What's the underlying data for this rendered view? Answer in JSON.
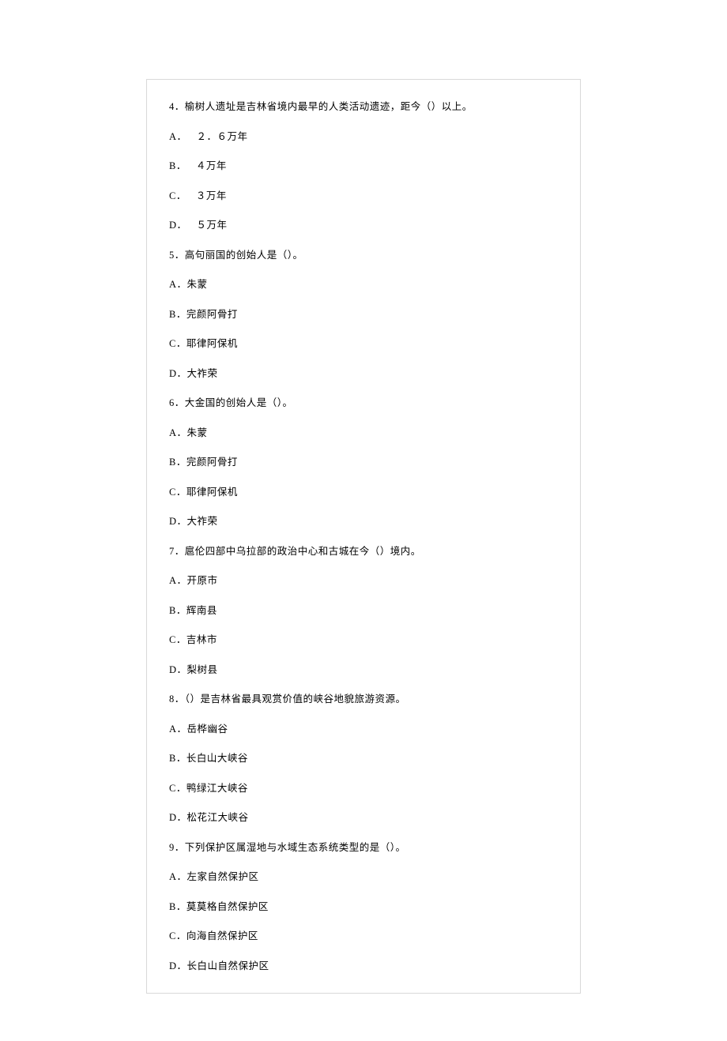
{
  "questions": [
    {
      "num": "4．",
      "stem": "榆树人遗址是吉林省境内最早的人类活动遗迹，距今（）以上。",
      "options": [
        {
          "letter": "A．",
          "text": "２．６万年",
          "wide": true
        },
        {
          "letter": "B．",
          "text": "４万年",
          "wide": true
        },
        {
          "letter": "C．",
          "text": "３万年",
          "wide": true
        },
        {
          "letter": "D．",
          "text": "５万年",
          "wide": true
        }
      ]
    },
    {
      "num": "5．",
      "stem": "高句丽国的创始人是（）。",
      "options": [
        {
          "letter": "A．",
          "text": "朱蒙"
        },
        {
          "letter": "B．",
          "text": "完颜阿骨打"
        },
        {
          "letter": "C．",
          "text": "耶律阿保机"
        },
        {
          "letter": "D．",
          "text": "大祚荣"
        }
      ]
    },
    {
      "num": "6．",
      "stem": "大金国的创始人是（）。",
      "options": [
        {
          "letter": "A．",
          "text": "朱蒙"
        },
        {
          "letter": "B．",
          "text": "完颜阿骨打"
        },
        {
          "letter": "C．",
          "text": "耶律阿保机"
        },
        {
          "letter": "D．",
          "text": "大祚荣"
        }
      ]
    },
    {
      "num": "7．",
      "stem": "扈伦四部中乌拉部的政治中心和古城在今（）境内。",
      "options": [
        {
          "letter": "A．",
          "text": "开原市"
        },
        {
          "letter": "B．",
          "text": "辉南县"
        },
        {
          "letter": "C．",
          "text": "吉林市"
        },
        {
          "letter": "D．",
          "text": "梨树县"
        }
      ]
    },
    {
      "num": "8．",
      "stem": "（）是吉林省最具观赏价值的峡谷地貌旅游资源。",
      "options": [
        {
          "letter": "A．",
          "text": "岳桦幽谷"
        },
        {
          "letter": "B．",
          "text": "长白山大峡谷"
        },
        {
          "letter": "C．",
          "text": "鸭绿江大峡谷"
        },
        {
          "letter": "D．",
          "text": "松花江大峡谷"
        }
      ]
    },
    {
      "num": "9．",
      "stem": "下列保护区属湿地与水域生态系统类型的是（）。",
      "options": [
        {
          "letter": "A．",
          "text": "左家自然保护区"
        },
        {
          "letter": "B．",
          "text": "莫莫格自然保护区"
        },
        {
          "letter": "C．",
          "text": "向海自然保护区"
        },
        {
          "letter": "D．",
          "text": "长白山自然保护区"
        }
      ]
    }
  ]
}
